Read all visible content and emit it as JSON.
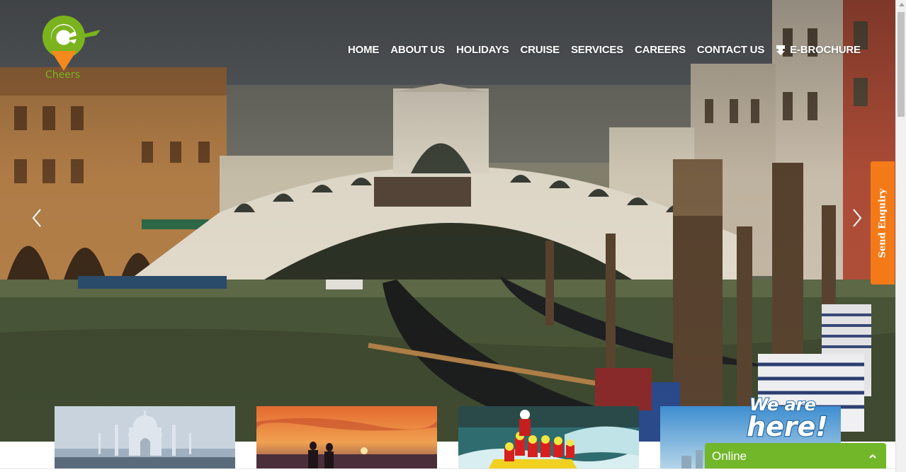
{
  "brand": {
    "name": "Cheers",
    "logo_icon": "location-pin-logo",
    "colors": {
      "logo_green": "#7ab31e",
      "logo_orange": "#f28a1e",
      "accent_orange": "#f47a18",
      "chat_green": "#72b62a"
    }
  },
  "nav": {
    "items": [
      {
        "label": "HOME"
      },
      {
        "label": "ABOUT US"
      },
      {
        "label": "HOLIDAYS"
      },
      {
        "label": "CRUISE"
      },
      {
        "label": "SERVICES"
      },
      {
        "label": "CAREERS"
      },
      {
        "label": "CONTACT US"
      },
      {
        "label": "E-BROCHURE",
        "icon": "download-icon"
      }
    ]
  },
  "slider": {
    "prev_icon": "chevron-left-icon",
    "next_icon": "chevron-right-icon"
  },
  "enquiry": {
    "label": "Send Enquiry"
  },
  "cards": [
    {
      "image": "taj-mahal-photo"
    },
    {
      "image": "sunset-couple-photo"
    },
    {
      "image": "river-rafting-photo"
    },
    {
      "image": "city-skyline-photo"
    }
  ],
  "chat": {
    "banner_text": "We are here!",
    "status": "Online",
    "toggle_icon": "chevron-up-icon"
  }
}
